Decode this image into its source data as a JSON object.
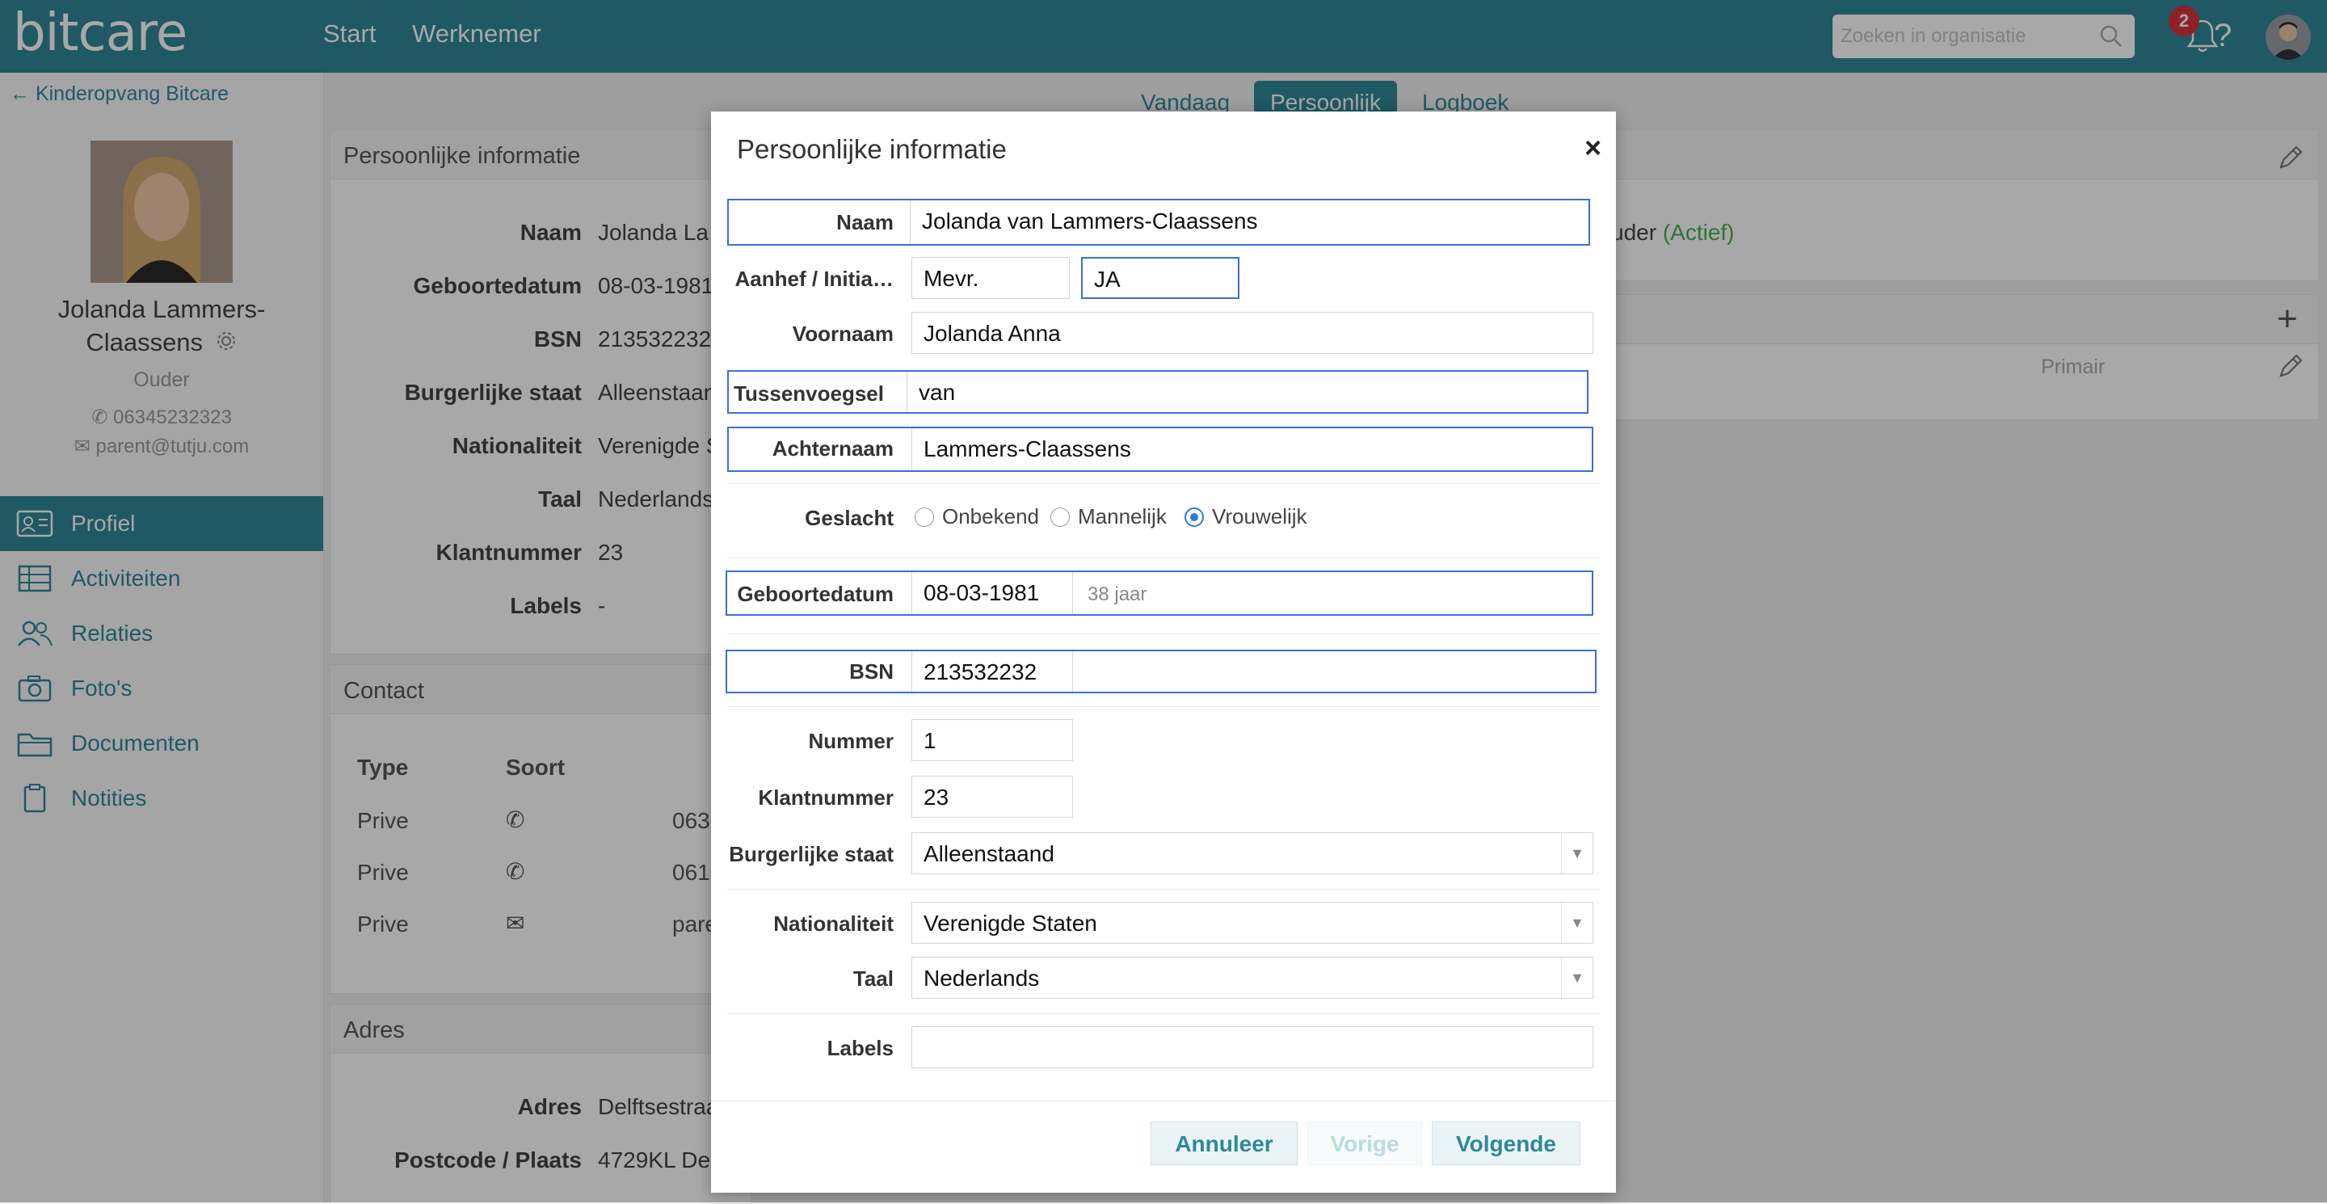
{
  "app": {
    "logo": "bitcare",
    "nav": [
      "Start",
      "Werknemer"
    ]
  },
  "topbar": {
    "search_placeholder": "Zoeken in organisatie",
    "notification_count": "2",
    "help": "?"
  },
  "sidebar": {
    "back_link": "Kinderopvang Bitcare",
    "name_line1": "Jolanda Lammers-",
    "name_line2": "Claassens",
    "role": "Ouder",
    "phone": "06345232323",
    "email": "parent@tutju.com",
    "menu": [
      {
        "label": "Profiel",
        "icon": "id-card-icon",
        "active": true
      },
      {
        "label": "Activiteiten",
        "icon": "table-icon"
      },
      {
        "label": "Relaties",
        "icon": "people-icon"
      },
      {
        "label": "Foto's",
        "icon": "camera-icon"
      },
      {
        "label": "Documenten",
        "icon": "folder-icon"
      },
      {
        "label": "Notities",
        "icon": "clipboard-icon"
      }
    ]
  },
  "tabs": [
    "Vandaag",
    "Persoonlijk",
    "Logboek"
  ],
  "background": {
    "personal_title": "Persoonlijke informatie",
    "rows": [
      {
        "label": "Naam",
        "value": "Jolanda La"
      },
      {
        "label": "Geboortedatum",
        "value": "08-03-1981"
      },
      {
        "label": "BSN",
        "value": "213532232"
      },
      {
        "label": "Burgerlijke staat",
        "value": "Alleenstaan"
      },
      {
        "label": "Nationaliteit",
        "value": "Verenigde S"
      },
      {
        "label": "Taal",
        "value": "Nederlands"
      },
      {
        "label": "Klantnummer",
        "value": "23"
      },
      {
        "label": "Labels",
        "value": "-"
      }
    ],
    "contact_title": "Contact",
    "contact_headers": [
      "Type",
      "Soort"
    ],
    "contact_rows": [
      {
        "type": "Prive",
        "value": "063"
      },
      {
        "type": "Prive",
        "value": "061"
      },
      {
        "type": "Prive",
        "value": "pare"
      }
    ],
    "address_title": "Adres",
    "address_rows": [
      {
        "label": "Adres",
        "value": "Delftsestraa"
      },
      {
        "label": "Postcode / Plaats",
        "value": "4729KL De"
      }
    ],
    "right_status": "uder (Actief)",
    "right_status_prefix": "uder ",
    "right_status_active": "(Actief)",
    "right_primary": "Primair"
  },
  "modal": {
    "title": "Persoonlijke informatie",
    "close": "×",
    "fields": {
      "naam": {
        "label": "Naam",
        "value": "Jolanda van Lammers-Claassens"
      },
      "aanhef": {
        "label": "Aanhef / Initia…",
        "salutation": "Mevr.",
        "initials": "JA"
      },
      "voornaam": {
        "label": "Voornaam",
        "value": "Jolanda Anna"
      },
      "tussenvoegsel": {
        "label": "Tussenvoegsel",
        "value": "van"
      },
      "achternaam": {
        "label": "Achternaam",
        "value": "Lammers-Claassens"
      },
      "geslacht": {
        "label": "Geslacht",
        "options": [
          "Onbekend",
          "Mannelijk",
          "Vrouwelijk"
        ],
        "selected": "Vrouwelijk"
      },
      "geboortedatum": {
        "label": "Geboortedatum",
        "value": "08-03-1981",
        "age": "38 jaar"
      },
      "bsn": {
        "label": "BSN",
        "value": "213532232"
      },
      "nummer": {
        "label": "Nummer",
        "value": "1"
      },
      "klantnummer": {
        "label": "Klantnummer",
        "value": "23"
      },
      "burgerlijke_staat": {
        "label": "Burgerlijke staat",
        "value": "Alleenstaand"
      },
      "nationaliteit": {
        "label": "Nationaliteit",
        "value": "Verenigde Staten"
      },
      "taal": {
        "label": "Taal",
        "value": "Nederlands"
      },
      "labels": {
        "label": "Labels",
        "value": ""
      }
    },
    "buttons": {
      "cancel": "Annuleer",
      "previous": "Vorige",
      "next": "Volgende"
    }
  },
  "colors": {
    "brand": "#2f8898",
    "focus": "#3a6fd8",
    "badge": "#d9333a",
    "active_status": "#4caf50"
  }
}
